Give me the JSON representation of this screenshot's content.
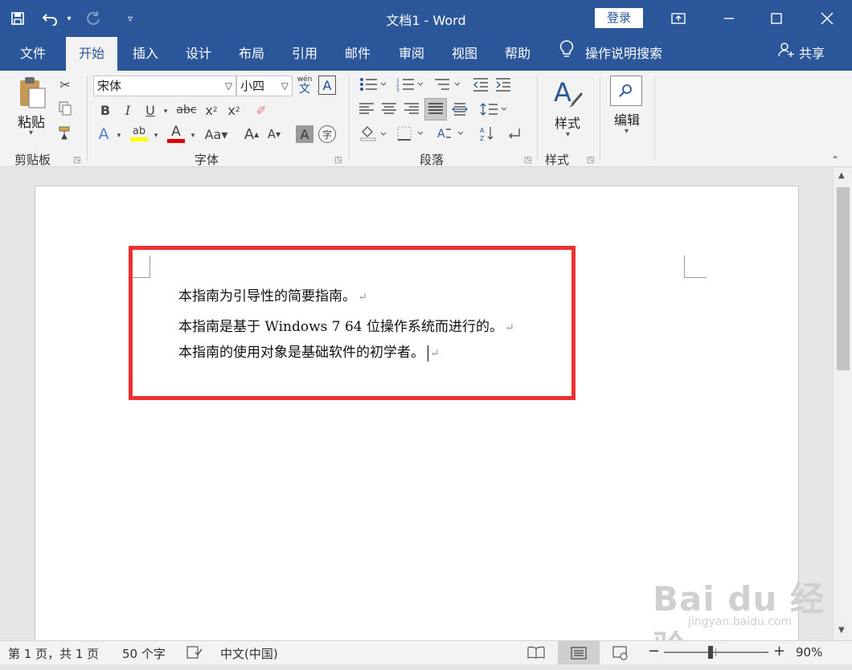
{
  "app": {
    "title": "文档1  -  Word",
    "login_label": "登录",
    "colors": {
      "accent": "#2b579a",
      "highlight_box": "#ee3030"
    }
  },
  "qat": {
    "save_icon": "save-icon",
    "undo_icon": "undo-icon",
    "redo_icon": "redo-icon",
    "customize_icon": "customize-icon"
  },
  "tabs": [
    "文件",
    "开始",
    "插入",
    "设计",
    "布局",
    "引用",
    "邮件",
    "审阅",
    "视图",
    "帮助"
  ],
  "tellme": "操作说明搜索",
  "share": "共享",
  "ribbon": {
    "clipboard": {
      "paste_label": "粘贴",
      "group_label": "剪贴板"
    },
    "font": {
      "font_name": "宋体",
      "font_size": "小四",
      "group_label": "字体",
      "phonetic_top": "wén",
      "phonetic_bottom": "文"
    },
    "paragraph": {
      "group_label": "段落"
    },
    "styles": {
      "styles_label": "样式",
      "group_label": "样式"
    },
    "editing": {
      "editing_label": "编辑"
    }
  },
  "document": {
    "lines": [
      "本指南为引导性的简要指南。",
      "本指南是基于  Windows 7 64 位操作系统而进行的。",
      "本指南的使用对象是基础软件的初学者。"
    ],
    "paragraph_mark": "↵"
  },
  "status": {
    "page": "第 1 页，共 1 页",
    "words": "50 个字",
    "language": "中文(中国)",
    "zoom": "90%"
  },
  "watermark": {
    "brand": "Bai du 经验",
    "url": "jingyan.baidu.com"
  }
}
